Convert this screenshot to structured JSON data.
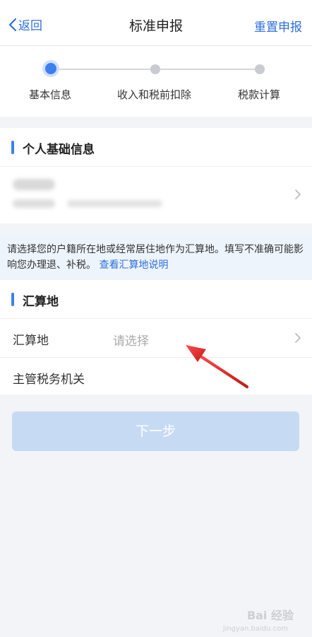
{
  "nav": {
    "back_label": "返回",
    "title": "标准申报",
    "reset_label": "重置申报"
  },
  "steps": [
    {
      "label": "基本信息",
      "active": true
    },
    {
      "label": "收入和税前扣除",
      "active": false
    },
    {
      "label": "税款计算",
      "active": false
    }
  ],
  "personal_section": {
    "title": "个人基础信息"
  },
  "notice": {
    "text": "请选择您的户籍所在地或经常居住地作为汇算地。填写不准确可能影响您办理退、补税。",
    "link": "查看汇算地说明"
  },
  "settlement_section": {
    "title": "汇算地",
    "rows": [
      {
        "label": "汇算地",
        "value": "请选择"
      },
      {
        "label": "主管税务机关",
        "value": ""
      }
    ]
  },
  "next_button": "下一步",
  "watermark": {
    "logo": "Bai 经验",
    "sub": "jingyan.baidu.com"
  },
  "colors": {
    "accent": "#2d6fdc",
    "step_active": "#3d7ff0",
    "button_disabled": "#c7daf3",
    "annotation_arrow": "#e8262a"
  }
}
